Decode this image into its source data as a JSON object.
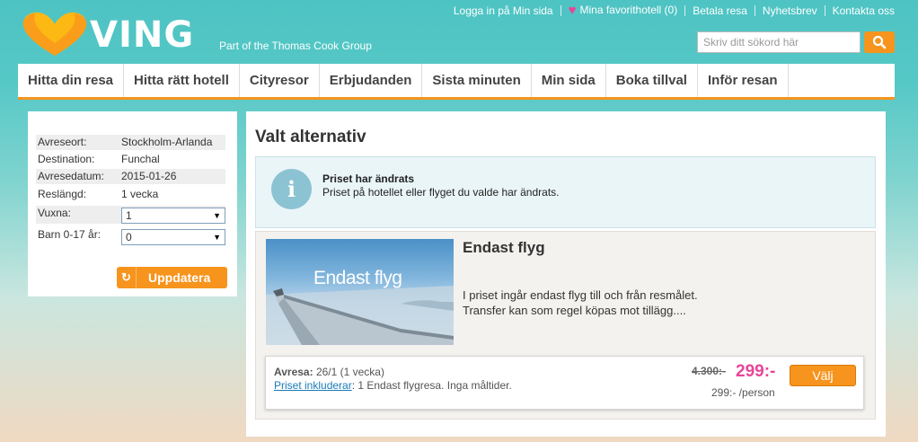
{
  "header": {
    "brand": "VING",
    "tagline": "Part of the Thomas Cook Group",
    "top_links": [
      "Logga in på Min sida",
      "Mina favorithotell (0)",
      "Betala resa",
      "Nyhetsbrev",
      "Kontakta oss"
    ],
    "search_placeholder": "Skriv ditt sökord här"
  },
  "nav": [
    "Hitta din resa",
    "Hitta rätt hotell",
    "Cityresor",
    "Erbjudanden",
    "Sista minuten",
    "Min sida",
    "Boka tillval",
    "Inför resan"
  ],
  "summary": {
    "rows": [
      {
        "label": "Avreseort:",
        "value": "Stockholm-Arlanda"
      },
      {
        "label": "Destination:",
        "value": "Funchal"
      },
      {
        "label": "Avresedatum:",
        "value": "2015-01-26"
      },
      {
        "label": "Reslängd:",
        "value": "1 vecka"
      }
    ],
    "adults_label": "Vuxna:",
    "adults_value": "1",
    "children_label": "Barn 0-17 år:",
    "children_value": "0",
    "update_button": "Uppdatera"
  },
  "main": {
    "title": "Valt alternativ",
    "info_title": "Priset har ändrats",
    "info_text": "Priset på hotellet eller flyget du valde har ändrats.",
    "offer": {
      "image_text": "Endast flyg",
      "title": "Endast flyg",
      "description": "I priset ingår endast flyg till och från resmålet. Transfer kan som regel köpas mot tillägg....",
      "avresa_label": "Avresa:",
      "avresa_value": "26/1 (1 vecka)",
      "included_link": "Priset inkluderar",
      "included_text": ": 1 Endast flygresa. Inga måltider.",
      "old_price": "4.300:-",
      "new_price": "299:-",
      "per_person": "299:- /person",
      "select_button": "Välj"
    }
  },
  "colors": {
    "accent": "#f7941d",
    "price": "#e8459a",
    "teal": "#4ec3c3"
  }
}
